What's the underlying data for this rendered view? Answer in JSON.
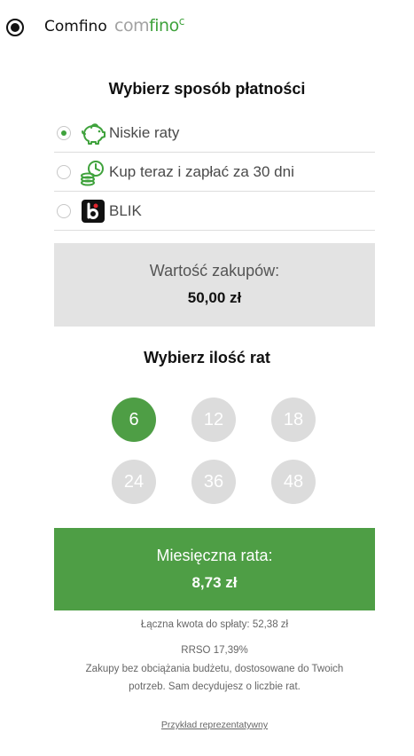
{
  "provider": {
    "name": "Comfino",
    "logo": {
      "part1": "com",
      "part2": "fino",
      "mark": "c"
    },
    "selected": true
  },
  "payment": {
    "title": "Wybierz sposób płatności",
    "options": [
      {
        "label": "Niskie raty",
        "icon": "piggy-bank-icon",
        "checked": true
      },
      {
        "label": "Kup teraz i zapłać za 30 dni",
        "icon": "clock-coins-icon",
        "checked": false
      },
      {
        "label": "BLIK",
        "icon": "blik-logo-icon",
        "checked": false
      }
    ]
  },
  "purchase": {
    "label": "Wartość zakupów:",
    "value": "50,00 zł"
  },
  "installments": {
    "title": "Wybierz ilość rat",
    "options": [
      "6",
      "12",
      "18",
      "24",
      "36",
      "48"
    ],
    "selected": "6"
  },
  "monthly": {
    "label": "Miesięczna rata:",
    "value": "8,73 zł"
  },
  "total": "Łączna kwota do spłaty: 52,38 zł",
  "rrso": "RRSO 17,39%",
  "description": {
    "line1": "Zakupy bez obciążania budżetu, dostosowane do Twoich",
    "line2": "potrzeb. Sam decydujesz o liczbie rat."
  },
  "example_link": "Przykład reprezentatywny",
  "colors": {
    "accent": "#4e9e45",
    "inactive": "#dcdcdc",
    "box_gray": "#e3e3e3"
  }
}
